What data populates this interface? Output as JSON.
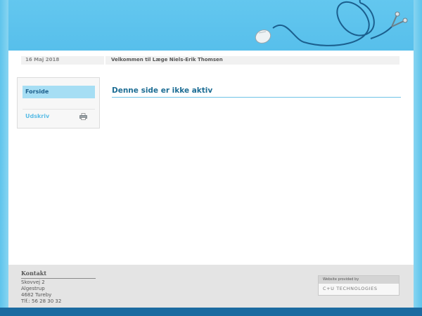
{
  "topbar": {
    "date": "16 Maj 2018",
    "welcome": "Velkommen til Læge Niels-Erik Thomsen"
  },
  "sidebar": {
    "items": [
      {
        "label": "Forside",
        "active": true
      },
      {
        "label": "Udskriv",
        "icon": "printer-icon"
      }
    ]
  },
  "main": {
    "title": "Denne side er ikke aktiv"
  },
  "footer": {
    "contact_title": "Kontakt",
    "address_lines": [
      "Skovvej 2",
      "Algestrup",
      "4682 Tureby",
      "Tlf.: 56 28 30 32"
    ],
    "provider_label": "Website provided by",
    "provider_name": "C+U TECHNOLOGIES"
  },
  "colors": {
    "header_blue": "#5ec4ec",
    "title_blue": "#1d6d94",
    "footer_gray": "#e4e4e4",
    "bottom_bar": "#1b6aa0"
  }
}
